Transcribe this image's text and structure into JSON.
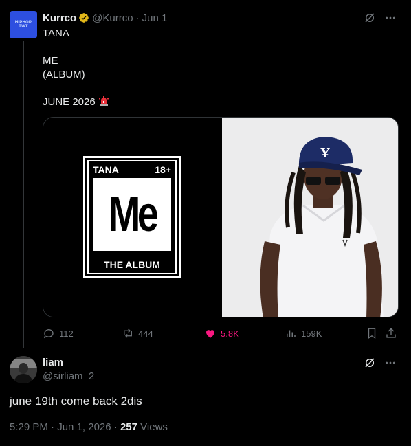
{
  "post": {
    "author_name": "Kurrco",
    "author_handle": "@Kurrco",
    "date": "Jun 1",
    "separator": "·",
    "avatar_text_1": "HIPHOP",
    "avatar_text_2": "TWT",
    "lines": [
      "TANA",
      "",
      "ME",
      "(ALBUM)",
      "",
      "JUNE 2026"
    ],
    "media": {
      "album": {
        "artist": "TANA",
        "rating": "18+",
        "title_big": "Me",
        "subtitle": "THE ALBUM"
      }
    },
    "actions": {
      "replies": "112",
      "reposts": "444",
      "likes": "5.8K",
      "views": "159K"
    },
    "colors": {
      "like": "#f91880",
      "verified": "#e2b719",
      "muted": "#71767b"
    }
  },
  "reply": {
    "author_name": "liam",
    "author_handle": "@sirliam_2",
    "text": "june 19th come back 2dis",
    "time": "5:29 PM",
    "date": "Jun 1, 2026",
    "views_count": "257",
    "views_label": "Views",
    "separator": "·"
  }
}
